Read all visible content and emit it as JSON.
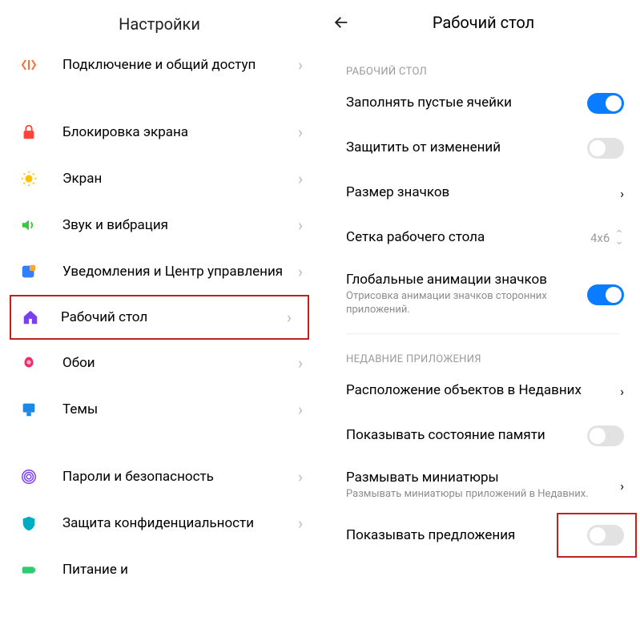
{
  "left": {
    "title": "Настройки",
    "items": [
      {
        "label": "Подключение и общий доступ"
      },
      {
        "label": "Блокировка экрана"
      },
      {
        "label": "Экран"
      },
      {
        "label": "Звук и вибрация"
      },
      {
        "label": "Уведомления и Центр управления"
      },
      {
        "label": "Рабочий стол"
      },
      {
        "label": "Обои"
      },
      {
        "label": "Темы"
      },
      {
        "label": "Пароли и безопасность"
      },
      {
        "label": "Защита конфиденциальности"
      },
      {
        "label": "Питание и"
      }
    ]
  },
  "right": {
    "title": "Рабочий стол",
    "section_desktop": "РАБОЧИЙ СТОЛ",
    "section_recent": "НЕДАВНИЕ ПРИЛОЖЕНИЯ",
    "fill_empty": "Заполнять пустые ячейки",
    "lock_layout": "Защитить от изменений",
    "icon_size": "Размер значков",
    "grid": "Сетка рабочего стола",
    "grid_value": "4x6",
    "global_anim": "Глобальные анимации значков",
    "global_anim_sub": "Отрисовка анимации значков сторонних приложений.",
    "recent_layout": "Расположение объектов в Недавних",
    "show_memory": "Показывать состояние памяти",
    "blur_thumbs": "Размывать миниатюры",
    "blur_thumbs_sub": "Размывать миниатюры приложений в Недавних.",
    "show_suggest": "Показывать предложения"
  }
}
